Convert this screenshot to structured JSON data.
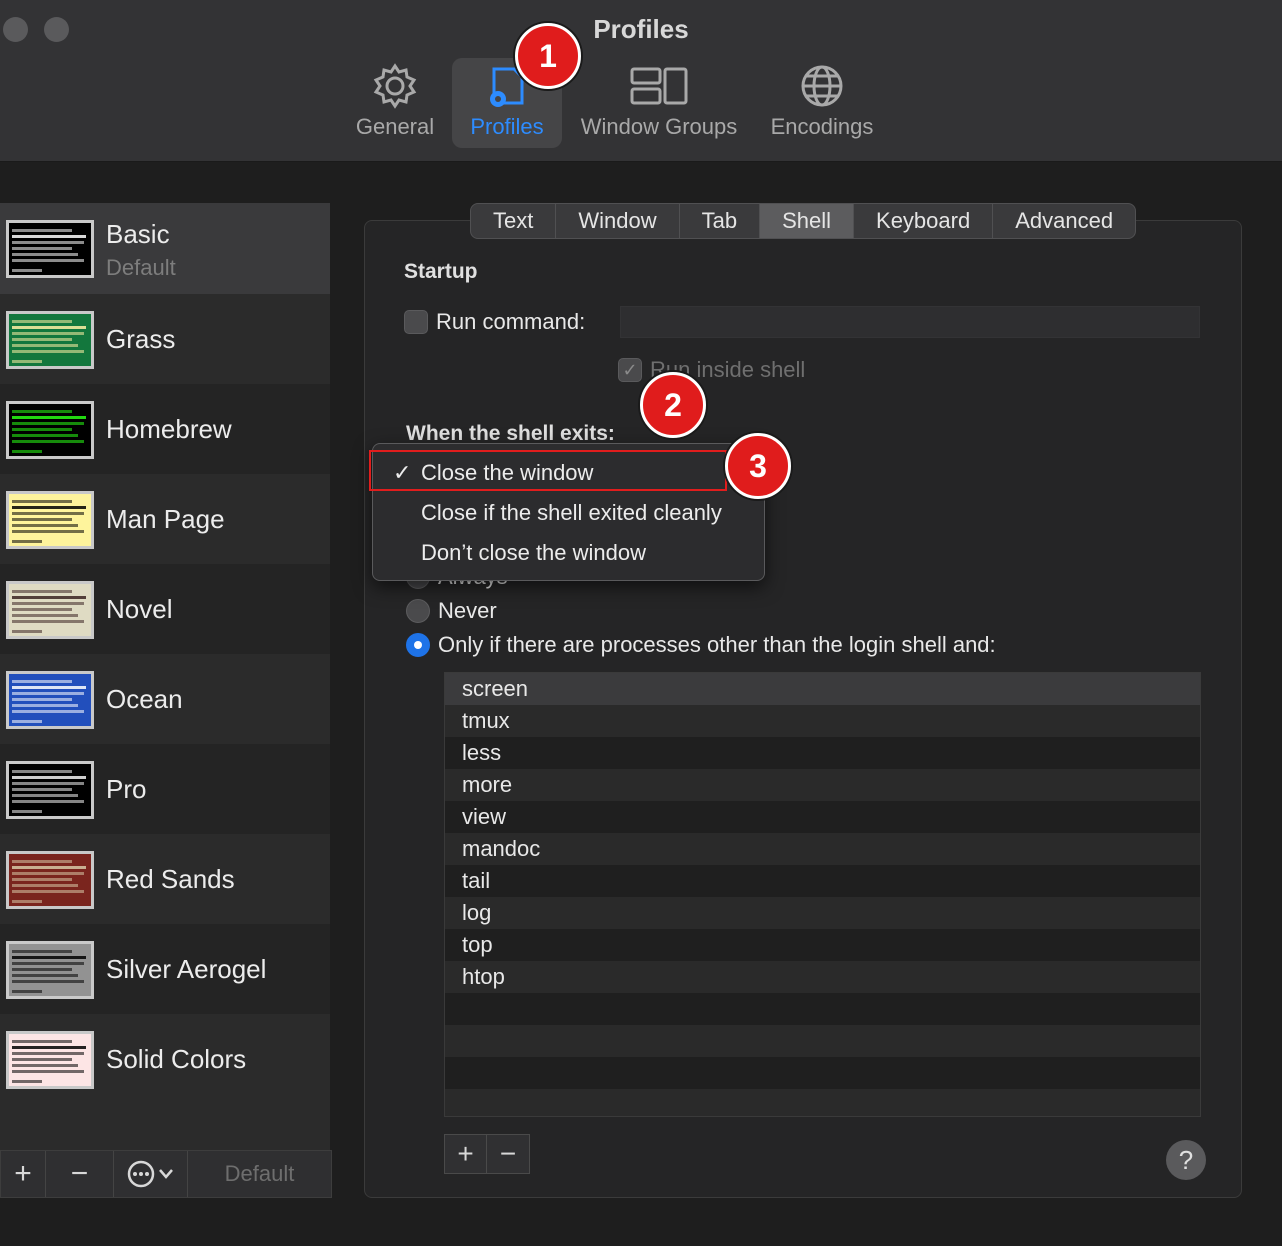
{
  "window": {
    "title": "Profiles"
  },
  "toolbar": {
    "items": [
      {
        "label": "General",
        "icon": "gear-icon"
      },
      {
        "label": "Profiles",
        "icon": "profiles-icon",
        "active": true
      },
      {
        "label": "Window Groups",
        "icon": "window-groups-icon"
      },
      {
        "label": "Encodings",
        "icon": "globe-icon"
      }
    ]
  },
  "sidebar": {
    "profiles": [
      {
        "name": "Basic",
        "subtitle": "Default",
        "bg": "#000000",
        "text": "#ffffff"
      },
      {
        "name": "Grass",
        "bg": "#13773d",
        "text": "#fff0a5"
      },
      {
        "name": "Homebrew",
        "bg": "#000000",
        "text": "#28fe14"
      },
      {
        "name": "Man Page",
        "bg": "#fef49c",
        "text": "#000000"
      },
      {
        "name": "Novel",
        "bg": "#dfdbc3",
        "text": "#3b2322"
      },
      {
        "name": "Ocean",
        "bg": "#224fbc",
        "text": "#ffffff"
      },
      {
        "name": "Pro",
        "bg": "#000000",
        "text": "#f2f2f2"
      },
      {
        "name": "Red Sands",
        "bg": "#7a251e",
        "text": "#d7c9a7"
      },
      {
        "name": "Silver Aerogel",
        "bg": "#929292",
        "text": "#000000"
      },
      {
        "name": "Solid Colors",
        "bg": "#fde5e5",
        "text": "#000000"
      }
    ],
    "bottom": {
      "add": "+",
      "remove": "−",
      "more": "⋯",
      "default_label": "Default"
    }
  },
  "tabs": [
    "Text",
    "Window",
    "Tab",
    "Shell",
    "Keyboard",
    "Advanced"
  ],
  "active_tab": "Shell",
  "startup": {
    "title": "Startup",
    "run_command_label": "Run command:",
    "run_command_value": "",
    "run_inside_shell_label": "Run inside shell"
  },
  "shell_exit": {
    "title": "When the shell exits:",
    "menu": [
      {
        "label": "Close the window",
        "checked": true
      },
      {
        "label": "Close if the shell exited cleanly",
        "checked": false
      },
      {
        "label": "Don’t close the window",
        "checked": false
      }
    ],
    "check_mark": "✓"
  },
  "ask_before_closing": {
    "options": [
      {
        "label": "Always",
        "selected": false
      },
      {
        "label": "Never",
        "selected": false
      },
      {
        "label": "Only if there are processes other than the login shell and:",
        "selected": true
      }
    ]
  },
  "process_list": [
    "screen",
    "tmux",
    "less",
    "more",
    "view",
    "mandoc",
    "tail",
    "log",
    "top",
    "htop"
  ],
  "process_list_buttons": {
    "add": "+",
    "remove": "−"
  },
  "help_label": "?",
  "markers": [
    "1",
    "2",
    "3"
  ],
  "colors": {
    "accent": "#2d8cff",
    "marker": "#e01c1c",
    "highlight": "#e11d1d"
  }
}
